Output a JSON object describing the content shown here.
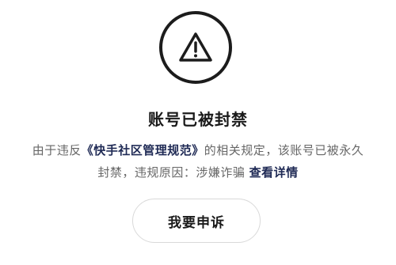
{
  "icon": "warning-triangle-icon",
  "title": "账号已被封禁",
  "description": {
    "prefix": "由于违反",
    "rule_name": "《快手社区管理规范》",
    "middle": "的相关规定，该账号已被永久封禁，违规原因：涉嫌诈骗 ",
    "detail_link": "查看详情"
  },
  "appeal_button": "我要申诉",
  "colors": {
    "link": "#1f2a55",
    "text_secondary": "#666666",
    "title": "#1a1a1a"
  }
}
